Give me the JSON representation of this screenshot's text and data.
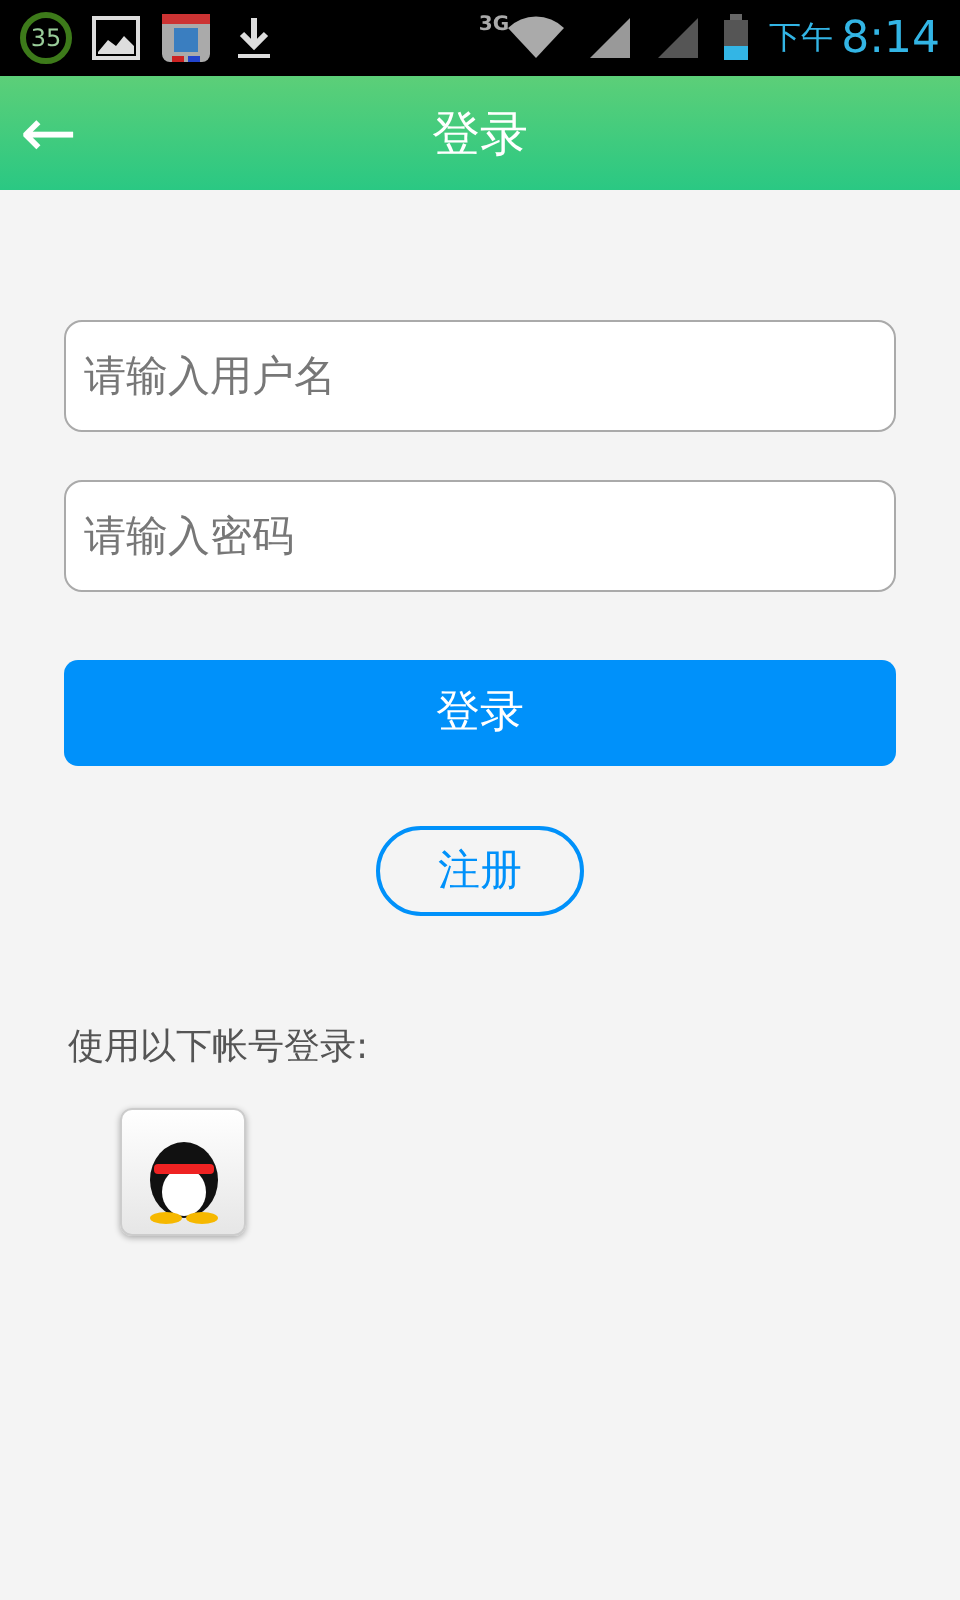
{
  "status_bar": {
    "badge": "35",
    "network": "3G",
    "period": "下午",
    "time": "8:14"
  },
  "header": {
    "back": "←",
    "title": "登录"
  },
  "fields": [
    {
      "placeholder": "请输入用户名"
    },
    {
      "placeholder": "请输入密码"
    }
  ],
  "login_button": "登录",
  "register_button": "注册",
  "other_login": {
    "label": "使用以下帐号登录:"
  }
}
